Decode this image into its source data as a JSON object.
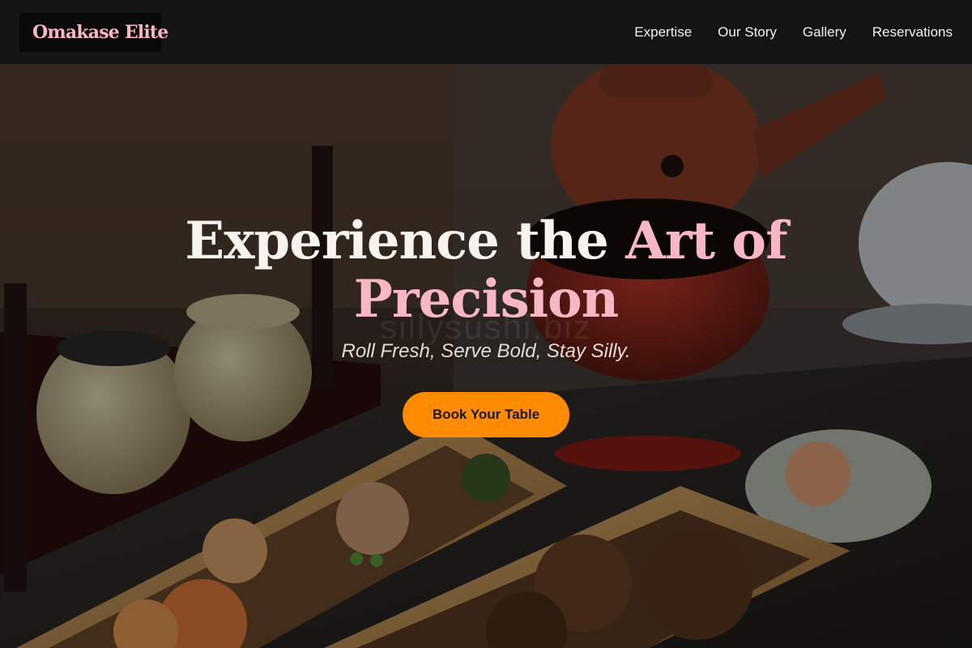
{
  "brand": {
    "name": "Omakase Elite",
    "accent_color": "#f7b7c4",
    "cta_color": "#ff8c00"
  },
  "nav": {
    "items": [
      {
        "label": "Expertise"
      },
      {
        "label": "Our Story"
      },
      {
        "label": "Gallery"
      },
      {
        "label": "Reservations"
      }
    ]
  },
  "hero": {
    "title_part1": "Experience the ",
    "title_accent": "Art of Precision",
    "watermark": "sillysushi.biz",
    "tagline": "Roll Fresh, Serve Bold, Stay Silly.",
    "cta_label": "Book Your Table",
    "background_image": "bento-boxes-teapot-photo"
  }
}
